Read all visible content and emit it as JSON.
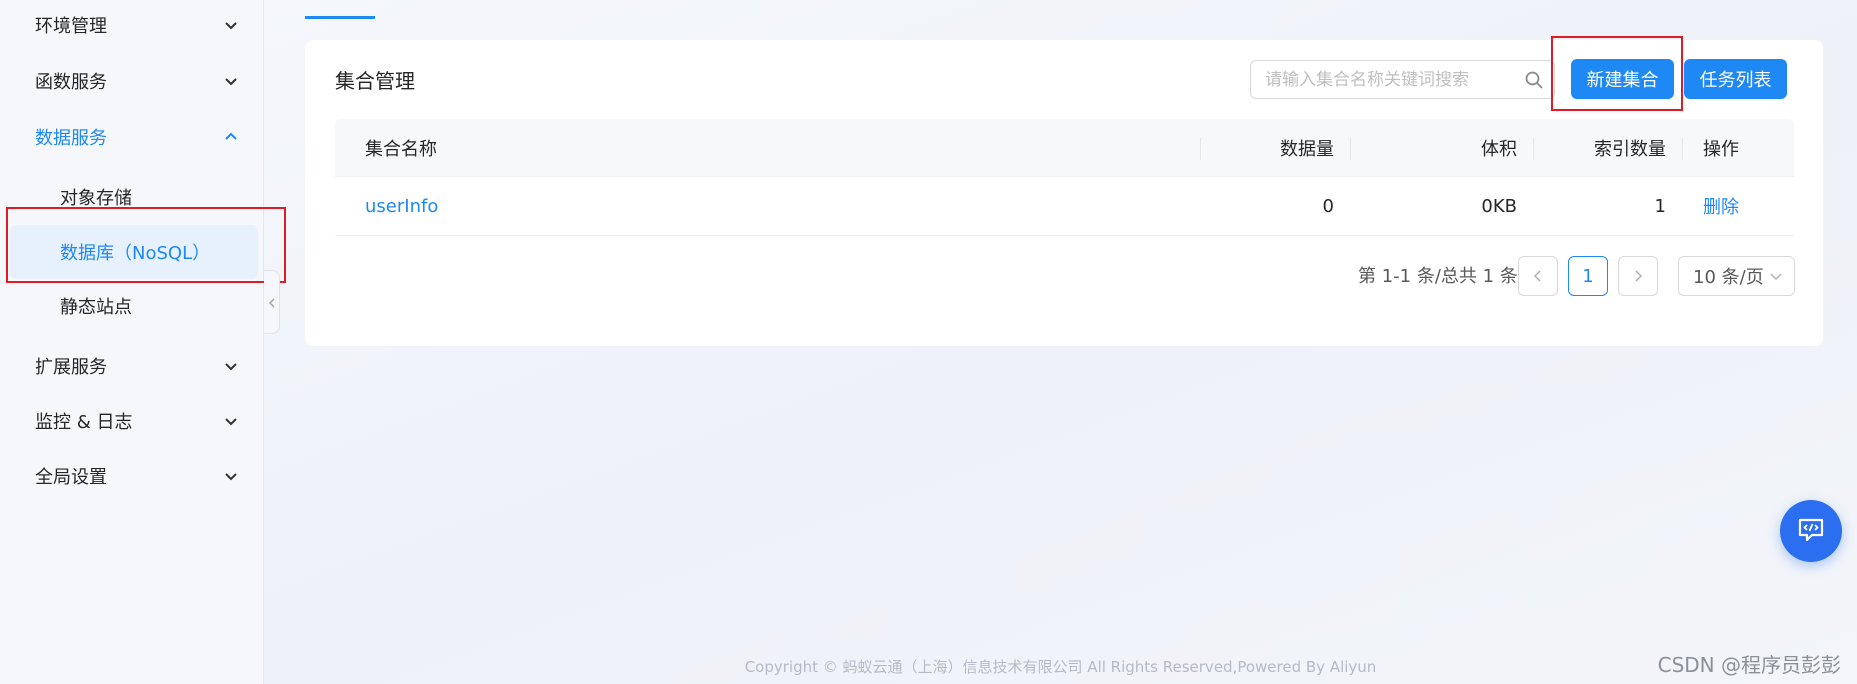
{
  "sidebar": {
    "items": [
      {
        "label": "环境管理",
        "expanded": false
      },
      {
        "label": "函数服务",
        "expanded": false
      },
      {
        "label": "数据服务",
        "expanded": true
      },
      {
        "label": "扩展服务",
        "expanded": false
      },
      {
        "label": "监控 & 日志",
        "expanded": false
      },
      {
        "label": "全局设置",
        "expanded": false
      }
    ],
    "sub_items": [
      {
        "label": "对象存储"
      },
      {
        "label": "数据库（NoSQL）",
        "selected": true
      },
      {
        "label": "静态站点"
      }
    ]
  },
  "card": {
    "title": "集合管理",
    "search_placeholder": "请输入集合名称关键词搜索",
    "create_button": "新建集合",
    "tasks_button": "任务列表"
  },
  "table": {
    "headers": [
      "集合名称",
      "数据量",
      "体积",
      "索引数量",
      "操作"
    ],
    "rows": [
      {
        "name": "userInfo",
        "count": "0",
        "size": "0KB",
        "indexes": "1",
        "action": "删除"
      }
    ]
  },
  "pagination": {
    "info": "第 1-1 条/总共 1 条",
    "current_page": "1",
    "page_size": "10 条/页"
  },
  "footer": "Copyright © 蚂蚁云通（上海）信息技术有限公司 All Rights Reserved,Powered By Aliyun",
  "watermark": "CSDN @程序员彭彭",
  "colors": {
    "accent": "#1e88f5",
    "highlight": "#e01b24",
    "float_button": "#2b6ff0"
  },
  "icons": [
    "chevron-down-icon",
    "chevron-up-icon",
    "chevron-left-icon",
    "search-icon",
    "chevron-right-icon",
    "code-chat-icon"
  ]
}
